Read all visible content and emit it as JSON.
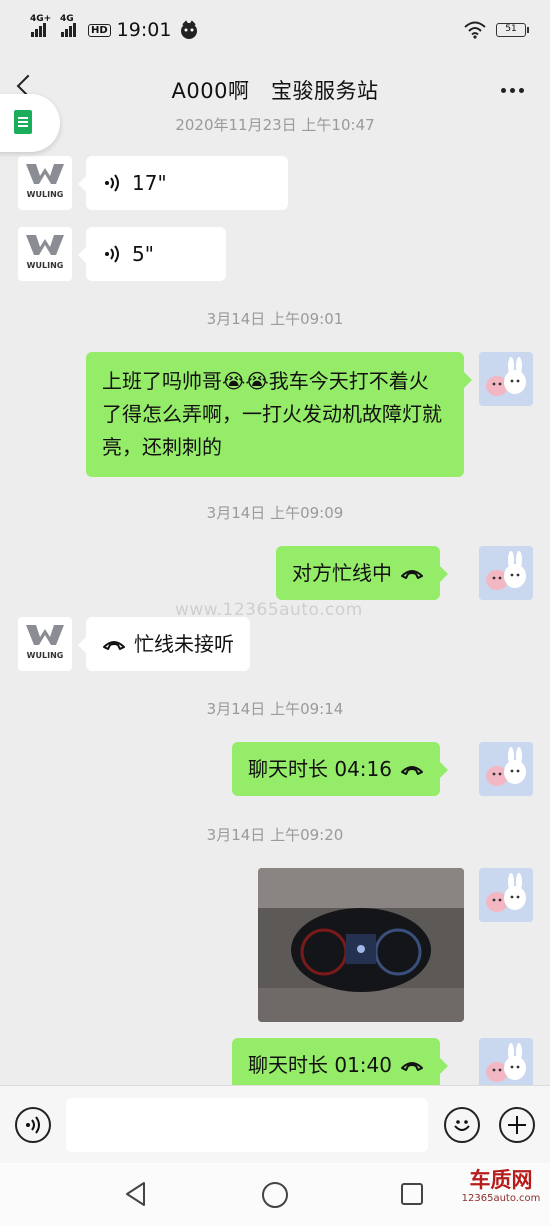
{
  "status_bar": {
    "signal_1_label": "4G+",
    "signal_2_label": "4G",
    "hd_label": "HD",
    "time": "19:01",
    "battery": "51"
  },
  "header": {
    "title": "A000啊　宝骏服务站",
    "partial_timestamp": "2020年11月23日 上午10:47"
  },
  "messages": {
    "voice_1_duration": "17\"",
    "voice_2_duration": "5\"",
    "ts_1": "3月14日 上午09:01",
    "text_1": "上班了吗帅哥😭😭我车今天打不着火了得怎么弄啊，一打火发动机故障灯就亮，还刺刺的",
    "ts_2": "3月14日 上午09:09",
    "call_1": "对方忙线中",
    "call_2": "忙线未接听",
    "ts_3": "3月14日 上午09:14",
    "call_3": "聊天时长 04:16",
    "ts_4": "3月14日 上午09:20",
    "call_4": "聊天时长 01:40"
  },
  "avatars": {
    "brand_text": "WULING"
  },
  "watermark": "www.12365auto.com",
  "logo": {
    "cn": "车质网",
    "en": "12365auto.com"
  },
  "colors": {
    "outgoing_bubble": "#95ec69",
    "incoming_bubble": "#ffffff",
    "background": "#ededed"
  },
  "icons": {
    "voice": "voice-wave-icon",
    "call": "phone-hangup-icon",
    "emoji": "smiley-icon",
    "plus": "plus-icon"
  }
}
